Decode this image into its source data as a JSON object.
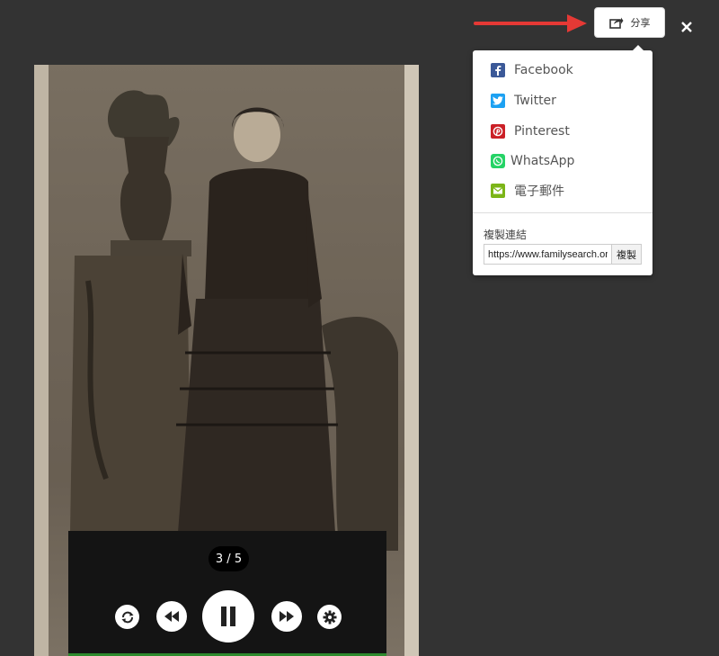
{
  "header": {
    "share_label": "分享",
    "share_icon": "share-icon",
    "close_icon": "close-icon"
  },
  "share_menu": {
    "items": [
      {
        "label": "Facebook",
        "icon": "facebook-icon",
        "color": "#3b5998"
      },
      {
        "label": "Twitter",
        "icon": "twitter-icon",
        "color": "#1da1f2"
      },
      {
        "label": "Pinterest",
        "icon": "pinterest-icon",
        "color": "#cb2027"
      },
      {
        "label": "WhatsApp",
        "icon": "whatsapp-icon",
        "color": "#25d366"
      },
      {
        "label": "電子郵件",
        "icon": "email-icon",
        "color": "#7cb518"
      }
    ],
    "copy_link_label": "複製連結",
    "link_value": "https://www.familysearch.or",
    "copy_button_label": "複製"
  },
  "player": {
    "counter": "3 / 5",
    "controls": [
      "loop-icon",
      "rewind-icon",
      "pause-icon",
      "forward-icon",
      "settings-icon"
    ]
  },
  "colors": {
    "background": "#333333",
    "arrow": "#e53935",
    "progress": "#2d8a2d"
  }
}
